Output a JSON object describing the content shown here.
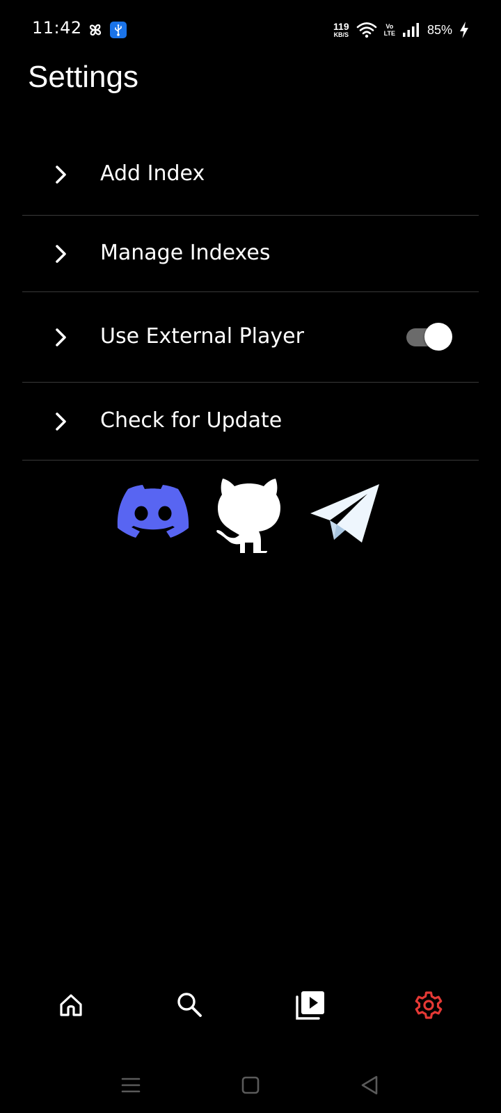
{
  "status_bar": {
    "time": "11:42",
    "net_speed_value": "119",
    "net_speed_unit": "KB/S",
    "volte_top": "Vo",
    "volte_bottom": "LTE",
    "battery_percent": "85%"
  },
  "page": {
    "title": "Settings"
  },
  "settings": {
    "items": [
      {
        "label": "Add Index"
      },
      {
        "label": "Manage Indexes"
      },
      {
        "label": "Use External Player",
        "toggle_on": true
      },
      {
        "label": "Check for Update"
      }
    ]
  },
  "social": {
    "icons": [
      "discord-icon",
      "github-icon",
      "telegram-icon"
    ],
    "colors": {
      "discord": "#5865F2",
      "github": "#FFFFFF",
      "telegram": "#EEF6FD"
    }
  },
  "bottom_nav": {
    "items": [
      "home-icon",
      "search-icon",
      "playlist-icon",
      "settings-icon"
    ],
    "active": "settings-icon",
    "active_color": "#E53935",
    "inactive_color": "#FFFFFF"
  },
  "colors": {
    "background": "#000000",
    "divider": "#3A3A3A",
    "toggle_track": "#6B6B6B",
    "toggle_thumb": "#FFFFFF"
  }
}
